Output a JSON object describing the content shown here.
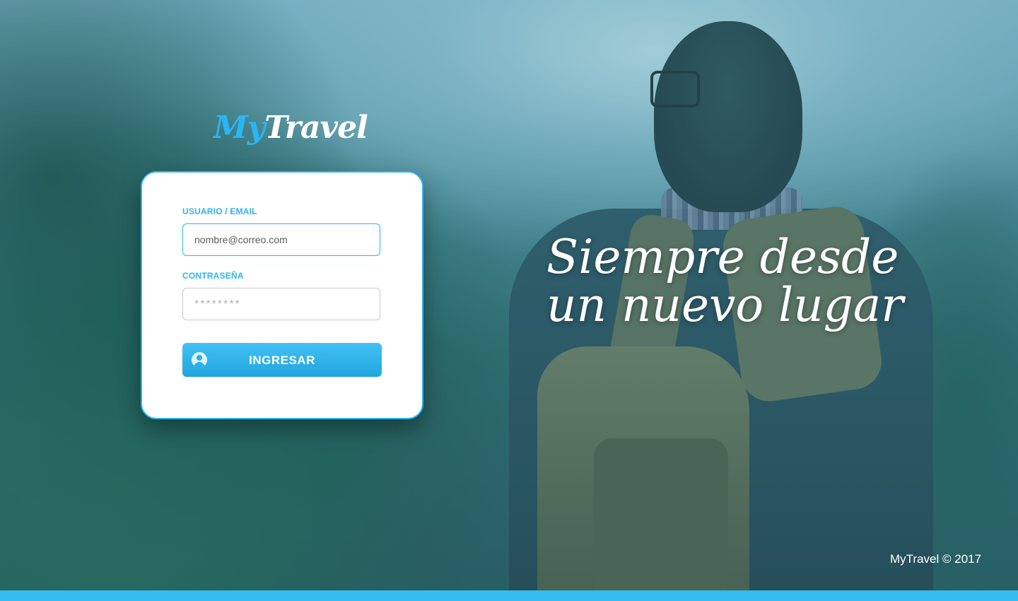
{
  "brand": {
    "my": "My",
    "travel": "Travel"
  },
  "login": {
    "user_label": "USUARIO / EMAIL",
    "user_placeholder": "nombre@correo.com",
    "password_label": "CONTRASEÑA",
    "password_placeholder": "********",
    "submit_label": "INGRESAR",
    "submit_icon": "user-circle-icon"
  },
  "headline": {
    "line1": "Siempre desde",
    "line2": "un nuevo lugar"
  },
  "footer": {
    "copyright": "MyTravel © 2017"
  },
  "colors": {
    "accent": "#29b6f6",
    "bar": "#35bdf2"
  }
}
